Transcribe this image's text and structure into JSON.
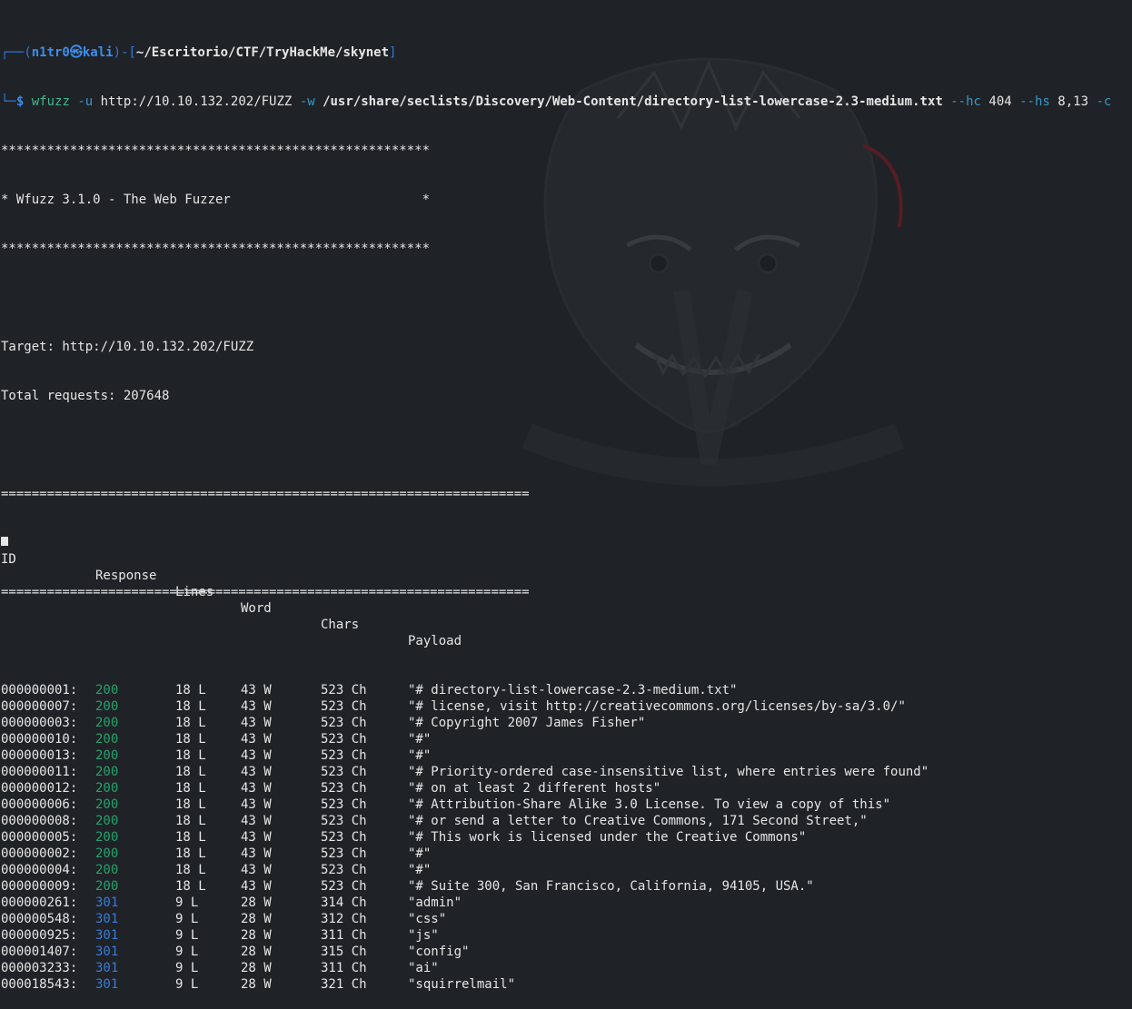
{
  "prompt": {
    "box_top": "┌──(",
    "user": "n1tr0",
    "at_symbol": "㉿",
    "host": "kali",
    "close_paren": ")-[",
    "path": "~/Escritorio/CTF/TryHackMe/skynet",
    "close_bracket": "]",
    "box_bottom": "└─",
    "dollar": "$",
    "cmd": "wfuzz",
    "flag_u": "-u",
    "url": "http://10.10.132.202/FUZZ",
    "flag_w": "-w",
    "wordlist": "/usr/share/seclists/Discovery/Web-Content/directory-list-lowercase-2.3-medium.txt",
    "flag_hc": "--hc",
    "hc_val": "404",
    "flag_hs": "--hs",
    "hs_val": "8,13",
    "flag_c": "-c"
  },
  "banner": {
    "stars": "********************************************************",
    "title": "* Wfuzz 3.1.0 - The Web Fuzzer                         *"
  },
  "info": {
    "target": "Target: http://10.10.132.202/FUZZ",
    "total": "Total requests: 207648"
  },
  "separator": "=====================================================================",
  "headers": {
    "id": "ID",
    "response": "Response",
    "lines": "Lines",
    "word": "Word",
    "chars": "Chars",
    "payload": "Payload"
  },
  "results": [
    {
      "id": "000000001:",
      "code": "200",
      "lines": "18 L",
      "words": "43 W",
      "chars": "523 Ch",
      "payload": "\"# directory-list-lowercase-2.3-medium.txt\""
    },
    {
      "id": "000000007:",
      "code": "200",
      "lines": "18 L",
      "words": "43 W",
      "chars": "523 Ch",
      "payload": "\"# license, visit http://creativecommons.org/licenses/by-sa/3.0/\""
    },
    {
      "id": "000000003:",
      "code": "200",
      "lines": "18 L",
      "words": "43 W",
      "chars": "523 Ch",
      "payload": "\"# Copyright 2007 James Fisher\""
    },
    {
      "id": "000000010:",
      "code": "200",
      "lines": "18 L",
      "words": "43 W",
      "chars": "523 Ch",
      "payload": "\"#\""
    },
    {
      "id": "000000013:",
      "code": "200",
      "lines": "18 L",
      "words": "43 W",
      "chars": "523 Ch",
      "payload": "\"#\""
    },
    {
      "id": "000000011:",
      "code": "200",
      "lines": "18 L",
      "words": "43 W",
      "chars": "523 Ch",
      "payload": "\"# Priority-ordered case-insensitive list, where entries were found\""
    },
    {
      "id": "000000012:",
      "code": "200",
      "lines": "18 L",
      "words": "43 W",
      "chars": "523 Ch",
      "payload": "\"# on at least 2 different hosts\""
    },
    {
      "id": "000000006:",
      "code": "200",
      "lines": "18 L",
      "words": "43 W",
      "chars": "523 Ch",
      "payload": "\"# Attribution-Share Alike 3.0 License. To view a copy of this\""
    },
    {
      "id": "000000008:",
      "code": "200",
      "lines": "18 L",
      "words": "43 W",
      "chars": "523 Ch",
      "payload": "\"# or send a letter to Creative Commons, 171 Second Street,\""
    },
    {
      "id": "000000005:",
      "code": "200",
      "lines": "18 L",
      "words": "43 W",
      "chars": "523 Ch",
      "payload": "\"# This work is licensed under the Creative Commons\""
    },
    {
      "id": "000000002:",
      "code": "200",
      "lines": "18 L",
      "words": "43 W",
      "chars": "523 Ch",
      "payload": "\"#\""
    },
    {
      "id": "000000004:",
      "code": "200",
      "lines": "18 L",
      "words": "43 W",
      "chars": "523 Ch",
      "payload": "\"#\""
    },
    {
      "id": "000000009:",
      "code": "200",
      "lines": "18 L",
      "words": "43 W",
      "chars": "523 Ch",
      "payload": "\"# Suite 300, San Francisco, California, 94105, USA.\""
    },
    {
      "id": "000000261:",
      "code": "301",
      "lines": "9 L",
      "words": "28 W",
      "chars": "314 Ch",
      "payload": "\"admin\""
    },
    {
      "id": "000000548:",
      "code": "301",
      "lines": "9 L",
      "words": "28 W",
      "chars": "312 Ch",
      "payload": "\"css\""
    },
    {
      "id": "000000925:",
      "code": "301",
      "lines": "9 L",
      "words": "28 W",
      "chars": "311 Ch",
      "payload": "\"js\""
    },
    {
      "id": "000001407:",
      "code": "301",
      "lines": "9 L",
      "words": "28 W",
      "chars": "315 Ch",
      "payload": "\"config\""
    },
    {
      "id": "000003233:",
      "code": "301",
      "lines": "9 L",
      "words": "28 W",
      "chars": "311 Ch",
      "payload": "\"ai\""
    },
    {
      "id": "000018543:",
      "code": "301",
      "lines": "9 L",
      "words": "28 W",
      "chars": "321 Ch",
      "payload": "\"squirrelmail\""
    }
  ],
  "colors": {
    "background": "#1f2227",
    "status_200": "#26a269",
    "status_301": "#3a7bd5",
    "prompt": "#2f7ad8",
    "command": "#3fb98f"
  }
}
